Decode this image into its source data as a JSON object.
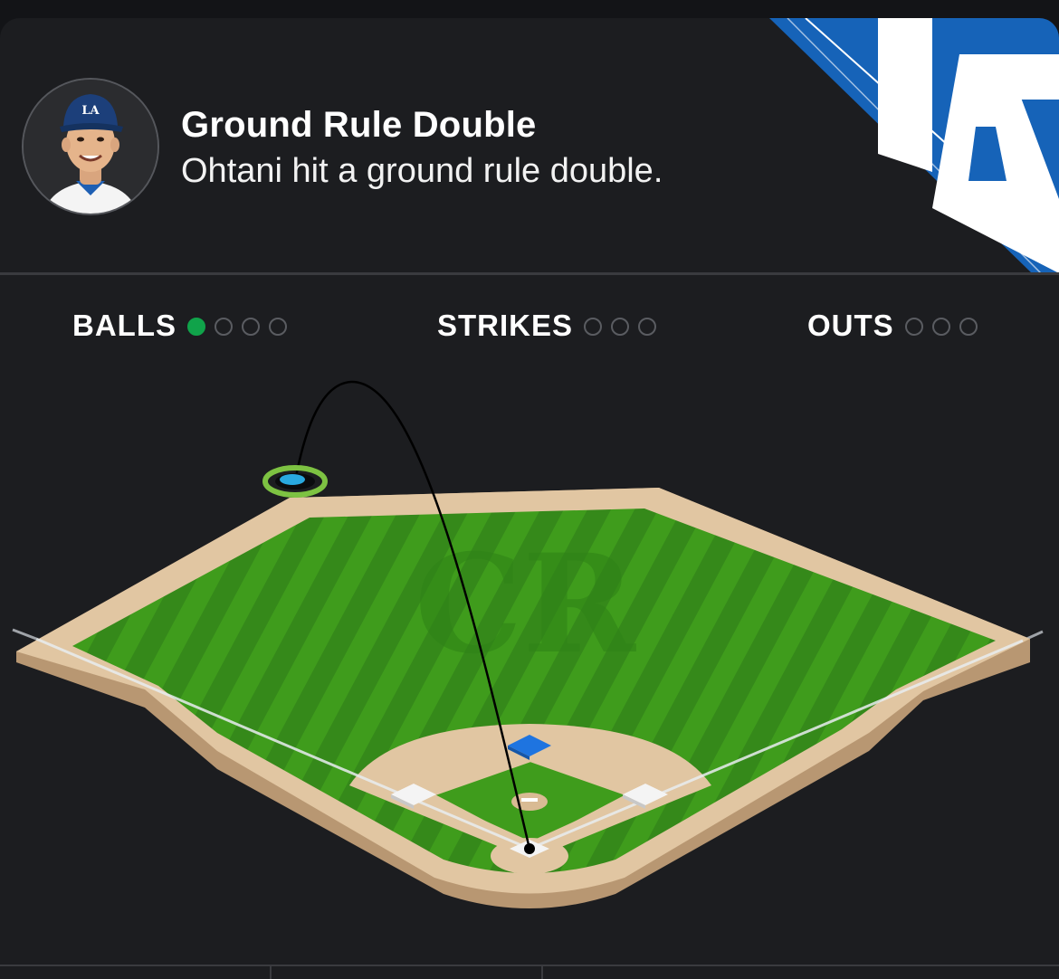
{
  "play": {
    "title": "Ground Rule Double",
    "description": "Ohtani hit a ground rule double."
  },
  "player": {
    "avatar_icon": "player-headshot",
    "cap_logo": "LA"
  },
  "team": {
    "logo_text": "LA",
    "color": "#1663b8"
  },
  "count": {
    "balls": {
      "label": "BALLS",
      "total": 4,
      "filled": 1
    },
    "strikes": {
      "label": "STRIKES",
      "total": 3,
      "filled": 0
    },
    "outs": {
      "label": "OUTS",
      "total": 3,
      "filled": 0
    }
  },
  "colors": {
    "background": "#1c1d20",
    "grass": "#3f9c1c",
    "dirt": "#e1c6a2",
    "active_dot": "#10a34a",
    "landing_ring": "#7dc242",
    "landing_spot": "#29a9e0",
    "mound_marker": "#1e74e0"
  }
}
